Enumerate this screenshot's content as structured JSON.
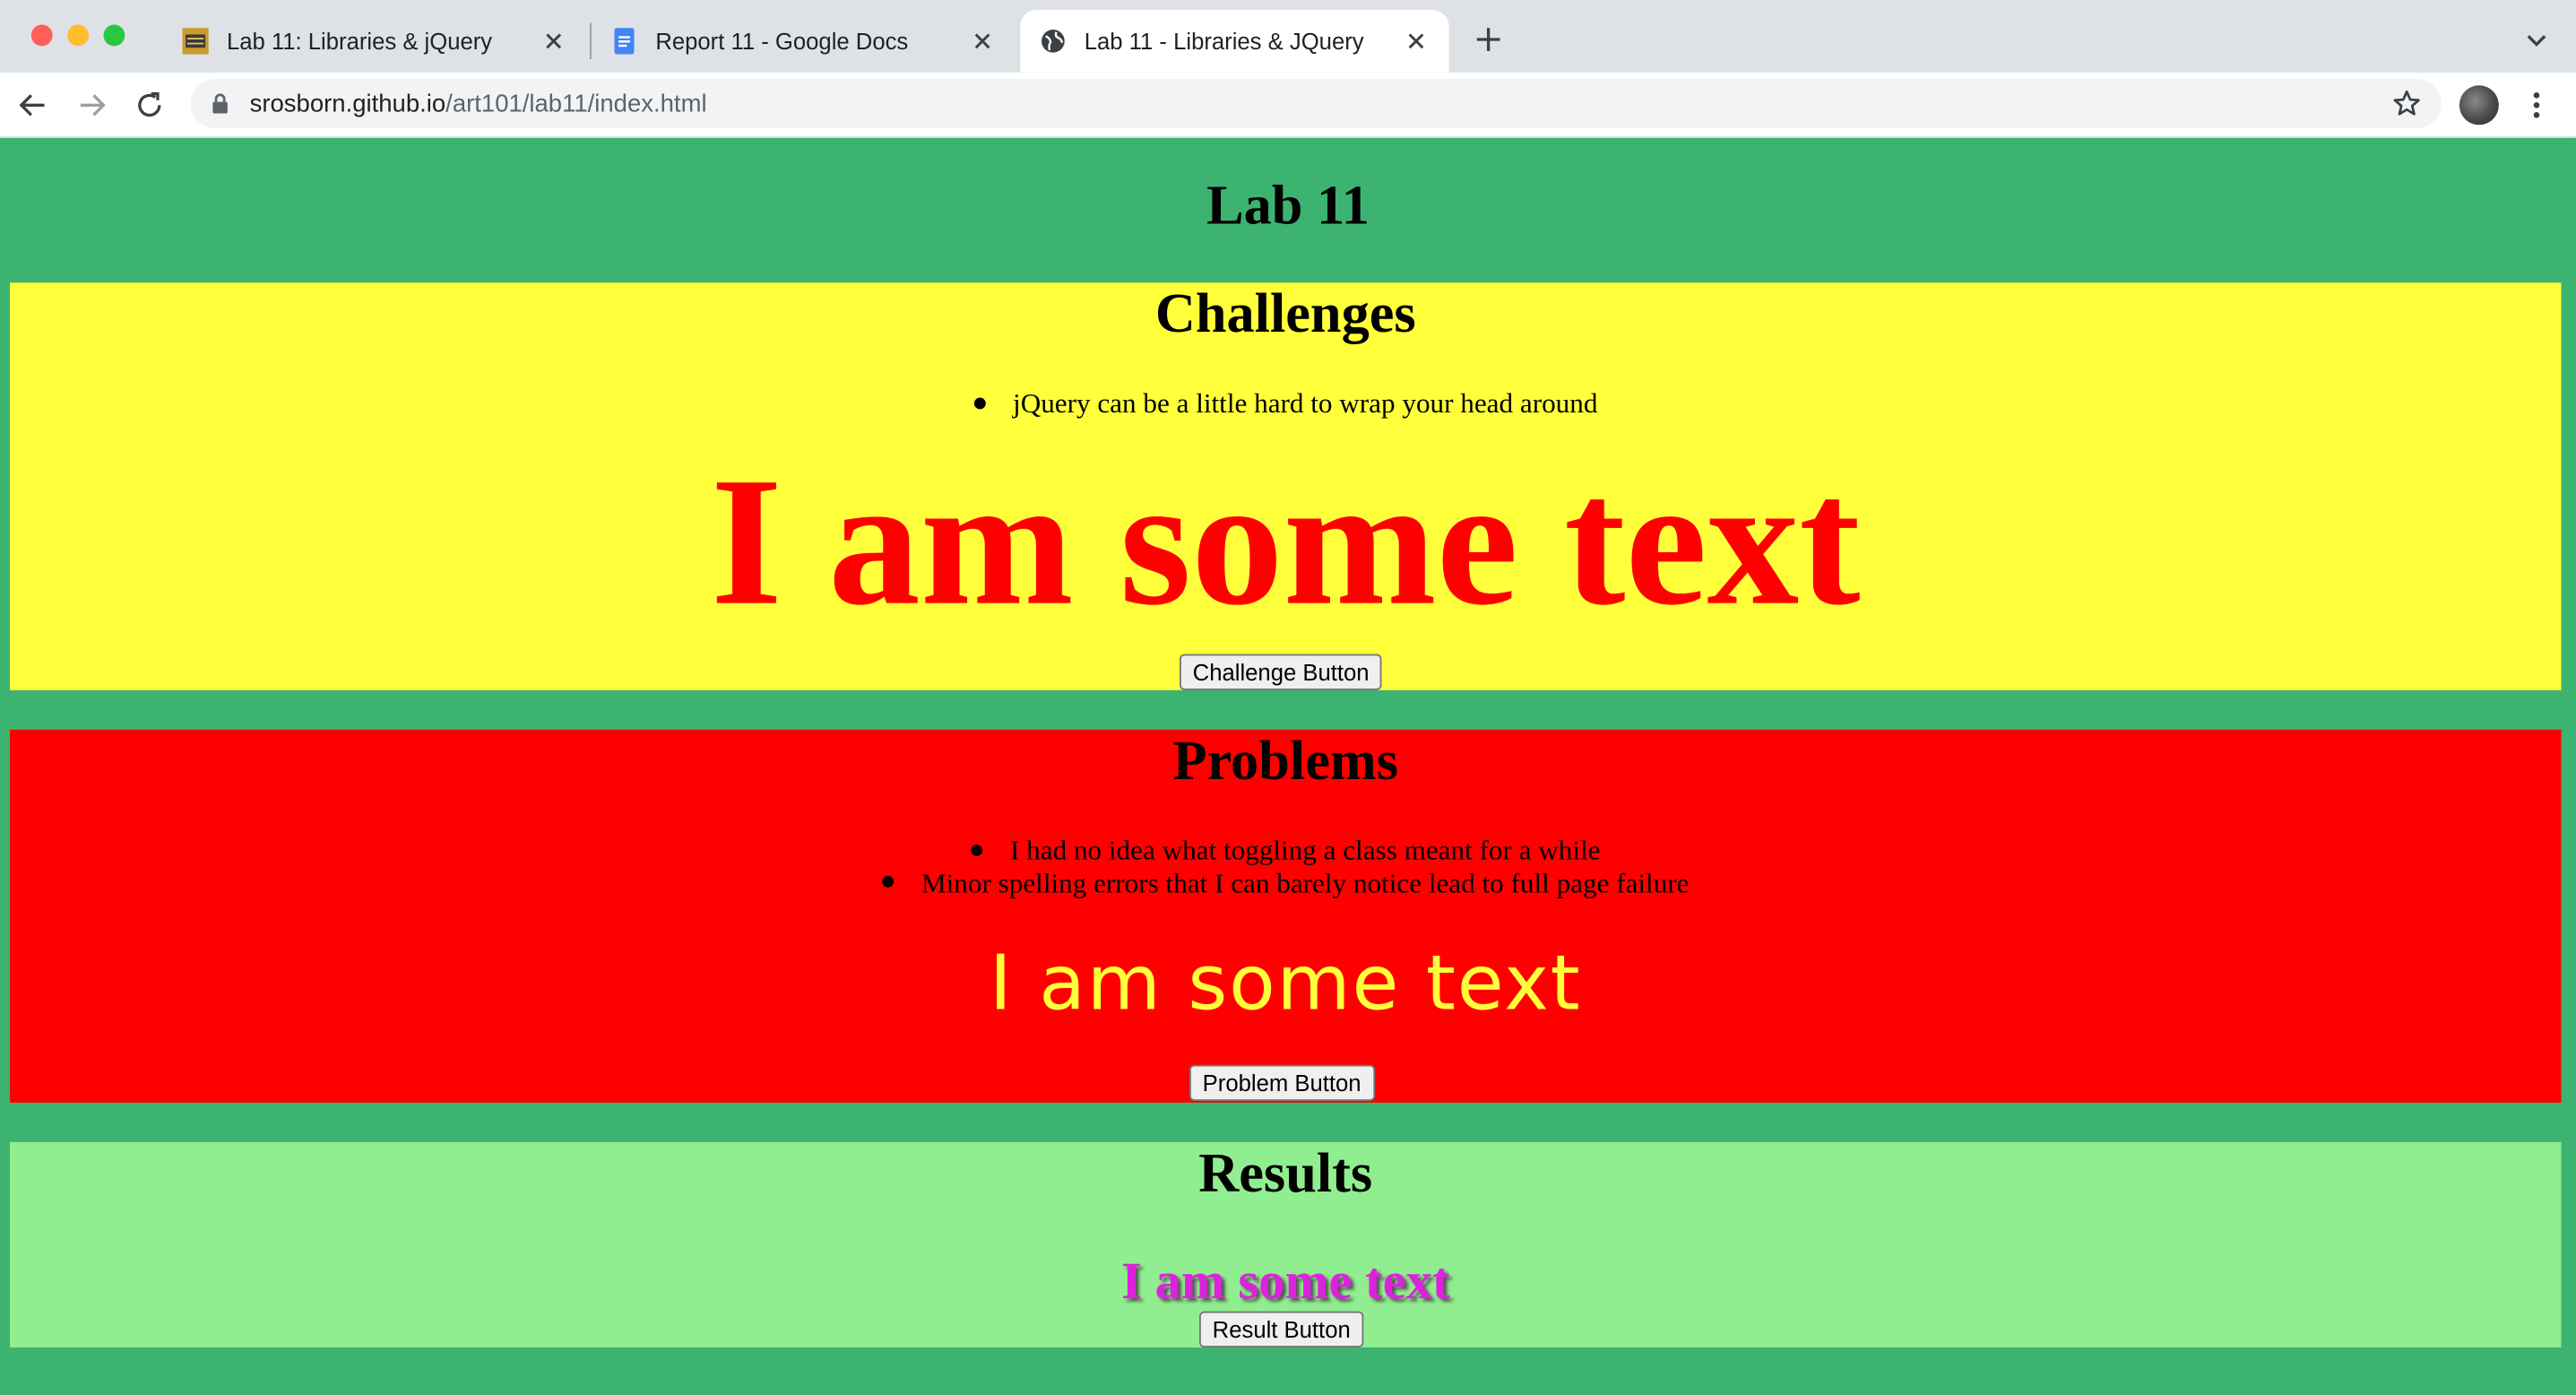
{
  "browser": {
    "tabs": [
      {
        "title": "Lab 11: Libraries & jQuery",
        "favicon": "ucsc-icon",
        "active": false
      },
      {
        "title": "Report 11 - Google Docs",
        "favicon": "google-docs-icon",
        "active": false
      },
      {
        "title": "Lab 11 - Libraries & JQuery",
        "favicon": "globe-icon",
        "active": true
      }
    ],
    "address": {
      "host": "srosborn.github.io",
      "path": "/art101/lab11/index.html"
    }
  },
  "page": {
    "title": "Lab 11",
    "background": "#3cb371",
    "challenges": {
      "heading": "Challenges",
      "items": [
        "jQuery can be a little hard to wrap your head around"
      ],
      "demo_text": "I am some text",
      "button": "Challenge Button",
      "background": "#ffff3c",
      "text_color": "#ff0000"
    },
    "problems": {
      "heading": "Problems",
      "items": [
        "I had no idea what toggling a class meant for a while",
        "Minor spelling errors that I can barely notice lead to full page failure"
      ],
      "demo_text": "I am some text",
      "button": "Problem Button",
      "background": "#ff0000",
      "text_color": "#ffff3c"
    },
    "results": {
      "heading": "Results",
      "demo_text": "I am some text",
      "button": "Result Button",
      "background": "#90ee90",
      "text_color": "#dd22dd"
    }
  }
}
